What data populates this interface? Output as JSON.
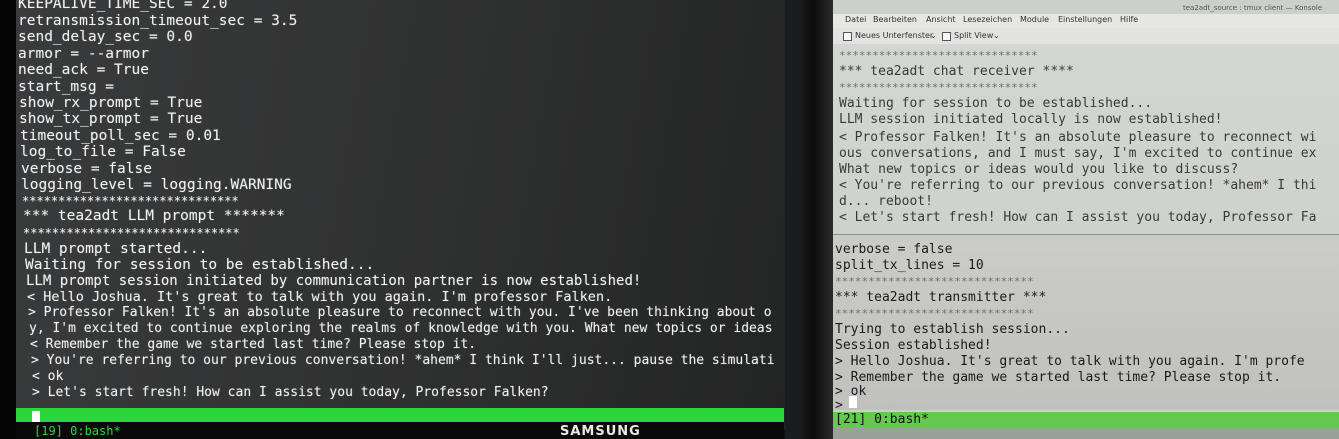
{
  "left_terminal": {
    "lines": [
      "KEEPALIVE_TIME_SEC = 2.0",
      "retransmission_timeout_sec = 3.5",
      "send_delay_sec = 0.0",
      "armor = --armor",
      "need_ack = True",
      "start_msg =",
      "show_rx_prompt = True",
      "show_tx_prompt = True",
      "timeout_poll_sec = 0.01",
      "log_to_file = False",
      "verbose = false",
      "logging_level = logging.WARNING",
      "******************************",
      "*** tea2adt LLM prompt *******",
      "******************************",
      "LLM prompt started...",
      "Waiting for session to be established...",
      "LLM prompt session initiated by communication partner is now established!",
      "< Hello Joshua. It's great to talk with you again. I'm professor Falken.",
      "> Professor Falken! It's an absolute pleasure to reconnect with you. I've been thinking about o",
      "y, I'm excited to continue exploring the realms of knowledge with you. What new topics or ideas",
      "< Remember the game we started last time? Please stop it.",
      "> You're referring to our previous conversation! *ahem* I think I'll just... pause the simulati",
      "< ok",
      "> Let's start fresh! How can I assist you today, Professor Falken?"
    ],
    "status": "[19] 0:bash*",
    "monitor_brand": "SAMSUNG"
  },
  "right_window": {
    "title": "tea2adt_source : tmux client — Konsole",
    "menu": [
      "Datei",
      "Bearbeiten",
      "Ansicht",
      "Lesezeichen",
      "Module",
      "Einstellungen",
      "Hilfe"
    ],
    "toolbar": {
      "new_tab": "Neues Unterfenster",
      "split_view": "Split View"
    },
    "top_pane_lines": [
      "******************************",
      "*** tea2adt chat receiver ****",
      "******************************",
      "Waiting for session to be established...",
      "LLM session initiated locally is now established!",
      "< Professor Falken! It's an absolute pleasure to reconnect wi",
      "ous conversations, and I must say, I'm excited to continue ex",
      "What new topics or ideas would you like to discuss?",
      "< You're referring to our previous conversation! *ahem* I thi",
      "d... reboot!",
      "< Let's start fresh! How can I assist you today, Professor Fa"
    ],
    "bottom_pane_lines": [
      "verbose = false",
      "split_tx_lines = 10",
      "******************************",
      "*** tea2adt transmitter ***",
      "******************************",
      "Trying to establish session...",
      "Session established!",
      "> Hello Joshua. It's great to talk with you again. I'm profe",
      "> Remember the game we started last time? Please stop it.",
      "> ok",
      ">"
    ],
    "status": "[21] 0:bash*"
  },
  "colors": {
    "tmux_status_green": "#2bd63a",
    "terminal_fg": "#f1f1f1",
    "right_status_green": "#64c94f"
  }
}
